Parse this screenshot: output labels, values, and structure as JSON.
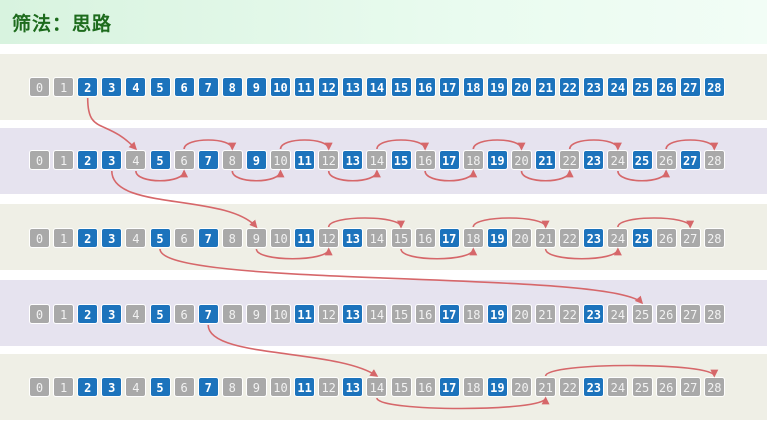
{
  "title": "筛法：思路",
  "numbers": [
    "0",
    "1",
    "2",
    "3",
    "4",
    "5",
    "6",
    "7",
    "8",
    "9",
    "10",
    "11",
    "12",
    "13",
    "14",
    "15",
    "16",
    "17",
    "18",
    "19",
    "20",
    "21",
    "22",
    "23",
    "24",
    "25",
    "26",
    "27",
    "28"
  ],
  "rows": [
    {
      "blue": [
        2,
        3,
        4,
        5,
        6,
        7,
        8,
        9,
        10,
        11,
        12,
        13,
        14,
        15,
        16,
        17,
        18,
        19,
        20,
        21,
        22,
        23,
        24,
        25,
        26,
        27,
        28
      ]
    },
    {
      "blue": [
        2,
        3,
        5,
        7,
        9,
        11,
        13,
        15,
        17,
        19,
        21,
        23,
        25,
        27
      ]
    },
    {
      "blue": [
        2,
        3,
        5,
        7,
        11,
        13,
        17,
        19,
        23,
        25
      ]
    },
    {
      "blue": [
        2,
        3,
        5,
        7,
        11,
        13,
        17,
        19,
        23
      ]
    },
    {
      "blue": [
        2,
        3,
        5,
        7,
        11,
        13,
        17,
        19,
        23
      ]
    }
  ],
  "transitions": [
    {
      "prime": 2,
      "marks": [
        4,
        6,
        8,
        10,
        12,
        14,
        16,
        18,
        20,
        22,
        24,
        26,
        28
      ]
    },
    {
      "prime": 3,
      "marks": [
        9,
        12,
        15,
        18,
        21,
        24,
        27
      ]
    },
    {
      "prime": 5,
      "marks": [
        25
      ]
    },
    {
      "prime": 7,
      "marks": []
    }
  ],
  "colors": {
    "prime_cell": "#1c73bc",
    "removed_cell": "#a9a9a9",
    "arrow": "#d6676a",
    "title": "#1d6b1d"
  }
}
